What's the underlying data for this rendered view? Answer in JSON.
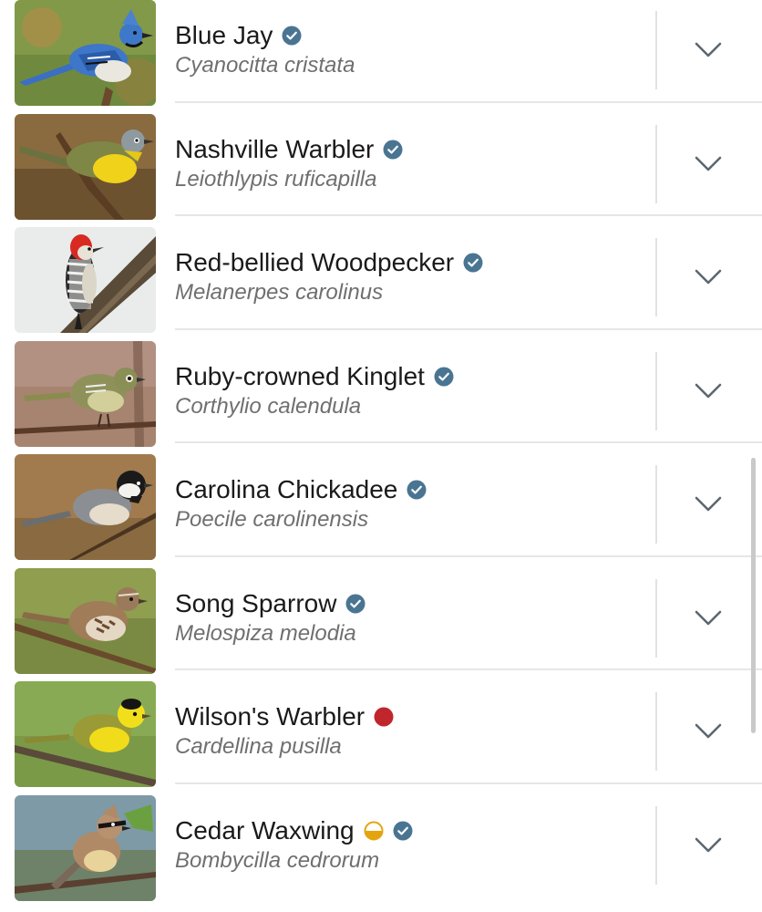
{
  "colors": {
    "verified_badge": "#4a7592",
    "status_red": "#c0262c",
    "status_half": "#e5a40f",
    "chevron": "#5c6770",
    "divider": "#e6e6e6"
  },
  "species": [
    {
      "common_name": "Blue Jay",
      "scientific_name": "Cyanocitta cristata",
      "badges": [
        "verified-icon"
      ],
      "photo": "blue-jay-photo",
      "expand_icon": "chevron-down-icon"
    },
    {
      "common_name": "Nashville Warbler",
      "scientific_name": "Leiothlypis ruficapilla",
      "badges": [
        "verified-icon"
      ],
      "photo": "nashville-warbler-photo",
      "expand_icon": "chevron-down-icon"
    },
    {
      "common_name": "Red-bellied Woodpecker",
      "scientific_name": "Melanerpes carolinus",
      "badges": [
        "verified-icon"
      ],
      "photo": "red-bellied-woodpecker-photo",
      "expand_icon": "chevron-down-icon"
    },
    {
      "common_name": "Ruby-crowned Kinglet",
      "scientific_name": "Corthylio calendula",
      "badges": [
        "verified-icon"
      ],
      "photo": "ruby-crowned-kinglet-photo",
      "expand_icon": "chevron-down-icon"
    },
    {
      "common_name": "Carolina Chickadee",
      "scientific_name": "Poecile carolinensis",
      "badges": [
        "verified-icon"
      ],
      "photo": "carolina-chickadee-photo",
      "expand_icon": "chevron-down-icon"
    },
    {
      "common_name": "Song Sparrow",
      "scientific_name": "Melospiza melodia",
      "badges": [
        "verified-icon"
      ],
      "photo": "song-sparrow-photo",
      "expand_icon": "chevron-down-icon"
    },
    {
      "common_name": "Wilson's Warbler",
      "scientific_name": "Cardellina pusilla",
      "badges": [
        "red-dot-icon"
      ],
      "photo": "wilsons-warbler-photo",
      "expand_icon": "chevron-down-icon"
    },
    {
      "common_name": "Cedar Waxwing",
      "scientific_name": "Bombycilla cedrorum",
      "badges": [
        "half-circle-icon",
        "verified-icon"
      ],
      "photo": "cedar-waxwing-photo",
      "expand_icon": "chevron-down-icon"
    }
  ]
}
